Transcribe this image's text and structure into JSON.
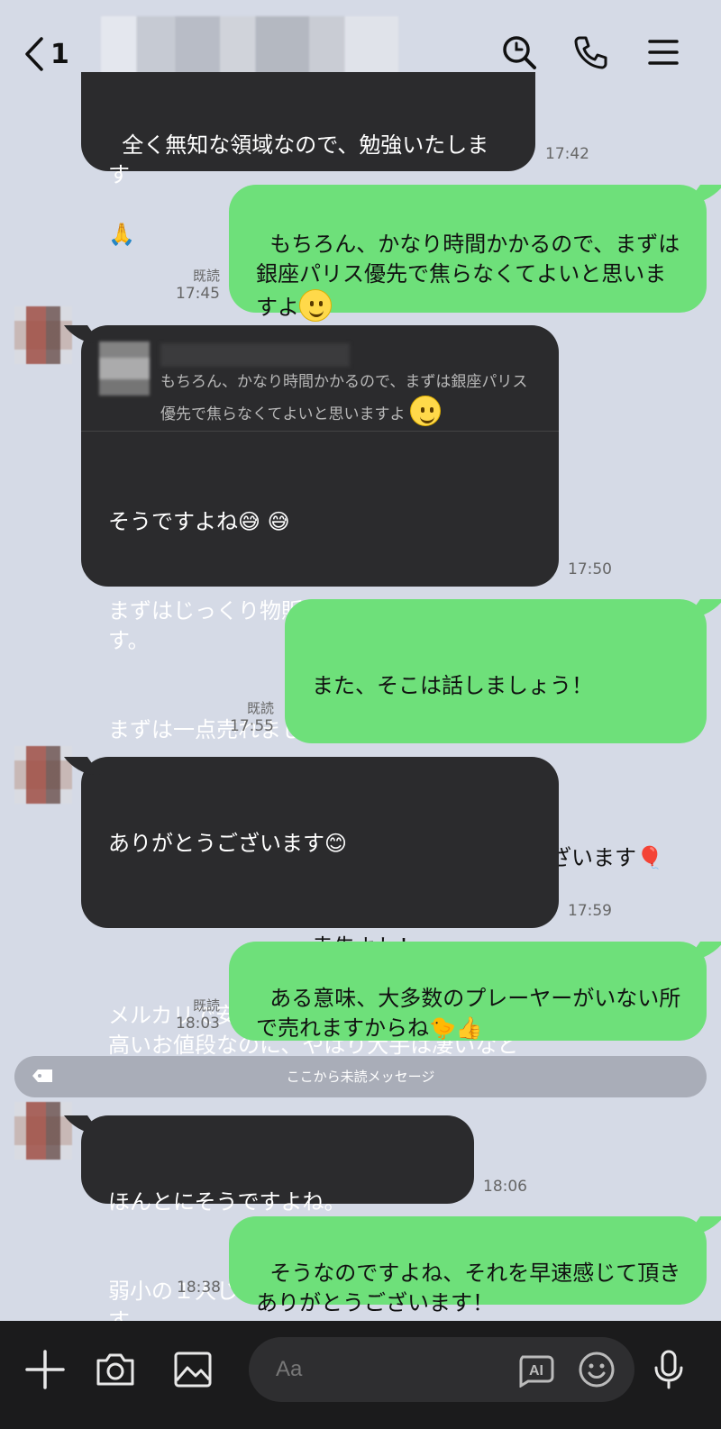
{
  "header": {
    "back_count": "1",
    "icons": [
      "back-chevron-icon",
      "search-icon",
      "phone-icon",
      "menu-icon"
    ]
  },
  "messages": [
    {
      "side": "left",
      "text": "全く無知な領域なので、勉強いたします",
      "emoji": "🙏",
      "time": "17:42"
    },
    {
      "side": "right",
      "text": "もちろん、かなり時間かかるので、まずは銀座パリス優先で焦らなくてよいと思いますよ",
      "read": "既読",
      "time": "17:45"
    },
    {
      "side": "left",
      "quote": "もちろん、かなり時間かかるので、まずは銀座パリス優先で焦らなくてよいと思いますよ",
      "line1": "そうですよね",
      "emoji1": "😅 😅",
      "line2": "まずはじっくり物販とまた向き合ってみます。",
      "line3": "まずは一点売れました",
      "emoji2": "🫡",
      "time": "17:50"
    },
    {
      "side": "right",
      "line1": "また、そこは話しましょう！",
      "line2": "売れたことおめでとうございます",
      "emoji": "🎈",
      "line3": "幸先よし！",
      "read": "既読",
      "time": "17:55"
    },
    {
      "side": "left",
      "line1": "ありがとうございます",
      "emoji": "😊",
      "line2": "メルカリで安値で出しても売れず、1万円も高いお値段なのに、やはり大手は凄いなと実感しました。",
      "time": "17:59"
    },
    {
      "side": "right",
      "text": "ある意味、大多数のプレーヤーがいない所で売れますからね",
      "emoji": "🐤👍",
      "read": "既読",
      "time": "18:03"
    },
    {
      "side": "left",
      "line1": "ほんとにそうですよね。",
      "line2": "弱小の１人じゃできない強みです。",
      "time": "18:06"
    },
    {
      "side": "right",
      "text": "そうなのですよね、それを早速感じて頂きありがとうございます！",
      "time": "18:38"
    }
  ],
  "unread_divider": "ここから未読メッセージ",
  "composer": {
    "placeholder": "Aa",
    "ai_label": "AI",
    "icons": [
      "plus-icon",
      "camera-icon",
      "image-icon",
      "ai-icon",
      "emoji-icon",
      "mic-icon"
    ]
  },
  "colors": {
    "background": "#d5dae6",
    "incoming_bubble": "#2b2b2d",
    "outgoing_bubble": "#6ee07a",
    "bottom_bar": "#1b1b1c"
  }
}
